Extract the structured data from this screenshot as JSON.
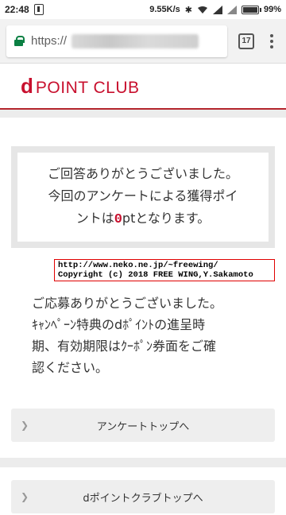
{
  "status_bar": {
    "time": "22:48",
    "speed": "9.55K/s",
    "battery": "99%"
  },
  "browser": {
    "url_scheme": "https://",
    "tab_count": "17"
  },
  "site": {
    "logo_d": "d",
    "logo_text": "POINT CLUB",
    "brand_color": "#c8102e"
  },
  "notice": {
    "line1": "ご回答ありがとうございました。",
    "line2": "今回のアンケートによる獲得ポイ",
    "line3_prefix": "ントは",
    "points": "0",
    "line3_suffix": "ptとなります。"
  },
  "copyright": {
    "line1": "http://www.neko.ne.jp/~freewing/",
    "line2": "Copyright (c) 2018 FREE WING,Y.Sakamoto"
  },
  "message": {
    "line1": "ご応募ありがとうございました。",
    "line2": "ｷｬﾝﾍﾟｰﾝ特典のdﾎﾟｲﾝﾄの進呈時",
    "line3": "期、有効期限はｸｰﾎﾟﾝ券面をご確",
    "line4": "認ください。"
  },
  "buttons": {
    "survey_top": "アンケートトップへ",
    "club_top": "dポイントクラブトップへ"
  }
}
